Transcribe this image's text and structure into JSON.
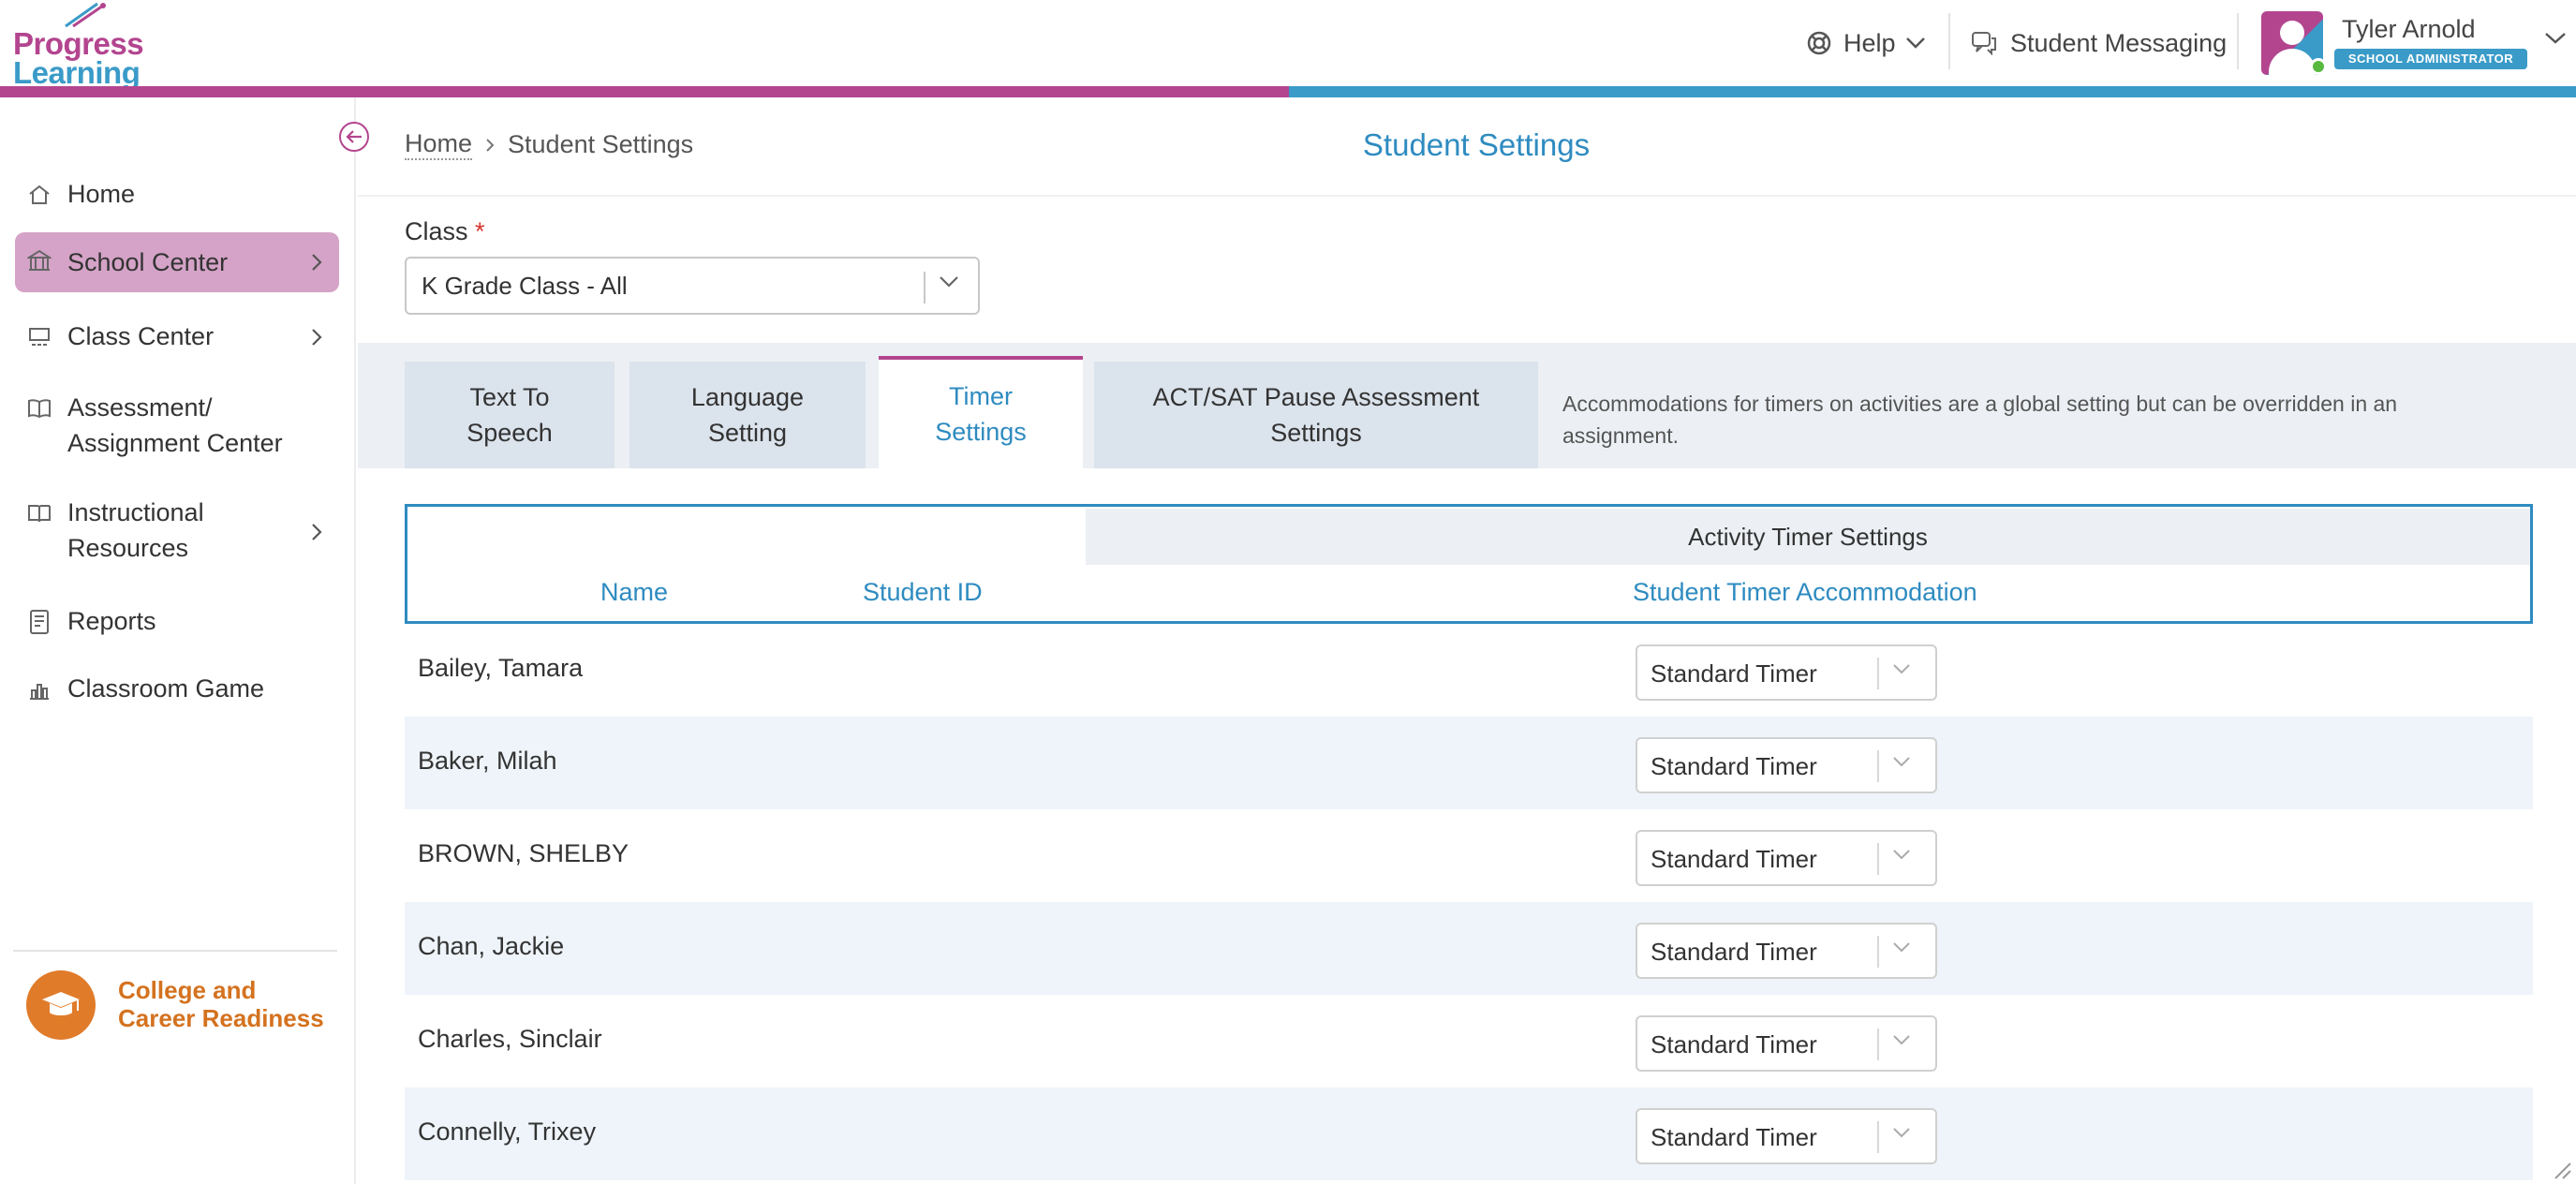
{
  "header": {
    "logo_line1": "Progress",
    "logo_line2": "Learning",
    "help_label": "Help",
    "messaging_label": "Student Messaging",
    "user_name": "Tyler Arnold",
    "user_role": "SCHOOL ADMINISTRATOR"
  },
  "colors": {
    "pink": "#b3458f",
    "blue": "#3a9bc8",
    "title_blue": "#2e8bc0",
    "active_nav": "#d5a3c7",
    "ccr_orange": "#e07b2a"
  },
  "sidebar": {
    "items": [
      {
        "label": "Home",
        "icon": "home-icon"
      },
      {
        "label": "School Center",
        "icon": "school-icon"
      },
      {
        "label": "Class Center",
        "icon": "classroom-icon"
      },
      {
        "label": "Assessment/\nAssignment Center",
        "icon": "book-open-icon"
      },
      {
        "label": "Instructional\nResources",
        "icon": "book-icon"
      },
      {
        "label": "Reports",
        "icon": "report-icon"
      },
      {
        "label": "Classroom Game",
        "icon": "game-icon"
      }
    ],
    "ccr_line1": "College and",
    "ccr_line2": "Career Readiness"
  },
  "breadcrumb": {
    "home": "Home",
    "current": "Student Settings"
  },
  "page_title": "Student Settings",
  "class_field": {
    "label": "Class",
    "required_mark": "*",
    "value": "K Grade Class - All"
  },
  "tabs": [
    {
      "label": "Text To\nSpeech"
    },
    {
      "label": "Language\nSetting"
    },
    {
      "label": "Timer\nSettings"
    },
    {
      "label": "ACT/SAT Pause Assessment\nSettings"
    }
  ],
  "tab_note": "Accommodations for timers on activities are a global setting but can be overridden in an assignment.",
  "table": {
    "group_header": "Activity Timer Settings",
    "columns": [
      "Name",
      "Student ID",
      "Student Timer Accommodation"
    ],
    "rows": [
      {
        "name": "Bailey, Tamara",
        "student_id": "",
        "timer": "Standard Timer"
      },
      {
        "name": "Baker, Milah",
        "student_id": "",
        "timer": "Standard Timer"
      },
      {
        "name": "BROWN, SHELBY",
        "student_id": "",
        "timer": "Standard Timer"
      },
      {
        "name": "Chan, Jackie",
        "student_id": "",
        "timer": "Standard Timer"
      },
      {
        "name": "Charles, Sinclair",
        "student_id": "",
        "timer": "Standard Timer"
      },
      {
        "name": "Connelly, Trixey",
        "student_id": "",
        "timer": "Standard Timer"
      }
    ]
  }
}
